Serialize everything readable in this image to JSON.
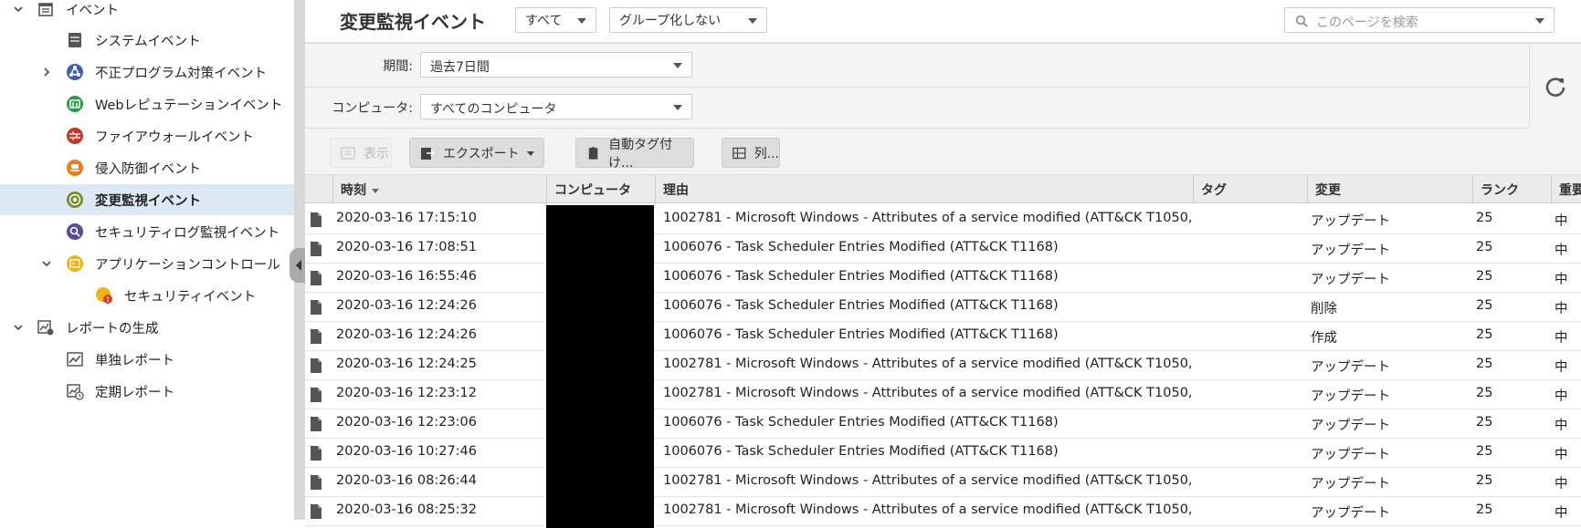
{
  "sidebar": {
    "items": [
      {
        "label": "イベント",
        "icon": "calendar-icon"
      },
      {
        "label": "システムイベント",
        "icon": "server-icon"
      },
      {
        "label": "不正プログラム対策イベント",
        "icon": "biohazard-icon"
      },
      {
        "label": "Webレピュテーションイベント",
        "icon": "web-reputation-icon"
      },
      {
        "label": "ファイアウォールイベント",
        "icon": "firewall-icon"
      },
      {
        "label": "侵入防御イベント",
        "icon": "intrusion-prevention-icon"
      },
      {
        "label": "変更監視イベント",
        "icon": "integrity-monitoring-icon"
      },
      {
        "label": "セキュリティログ監視イベント",
        "icon": "log-inspection-icon"
      },
      {
        "label": "アプリケーションコントロール",
        "icon": "application-control-icon"
      },
      {
        "label": "セキュリティイベント",
        "icon": "security-event-icon"
      },
      {
        "label": "レポートの生成",
        "icon": "report-generate-icon"
      },
      {
        "label": "単独レポート",
        "icon": "single-report-icon"
      },
      {
        "label": "定期レポート",
        "icon": "scheduled-report-icon"
      }
    ]
  },
  "header": {
    "title": "変更監視イベント",
    "filter_all": "すべて",
    "group_by": "グループ化しない",
    "search_placeholder": "このページを検索"
  },
  "filters": {
    "period_label": "期間:",
    "period_value": "過去7日間",
    "computer_label": "コンピュータ:",
    "computer_value": "すべてのコンピュータ"
  },
  "toolbar": {
    "view": "表示",
    "export": "エクスポート",
    "auto_tag": "自動タグ付け...",
    "columns": "列..."
  },
  "table": {
    "headers": [
      "時刻",
      "コンピュータ",
      "理由",
      "タグ",
      "変更",
      "ランク",
      "重要"
    ],
    "rows": [
      {
        "time": "2020-03-16 17:15:10",
        "reason": "1002781 - Microsoft Windows - Attributes of a service modified (ATT&CK T1050, ...",
        "change": "アップデート",
        "rank": "25",
        "severity": "中"
      },
      {
        "time": "2020-03-16 17:08:51",
        "reason": "1006076 - Task Scheduler Entries Modified (ATT&CK T1168)",
        "change": "アップデート",
        "rank": "25",
        "severity": "中"
      },
      {
        "time": "2020-03-16 16:55:46",
        "reason": "1006076 - Task Scheduler Entries Modified (ATT&CK T1168)",
        "change": "アップデート",
        "rank": "25",
        "severity": "中"
      },
      {
        "time": "2020-03-16 12:24:26",
        "reason": "1006076 - Task Scheduler Entries Modified (ATT&CK T1168)",
        "change": "削除",
        "rank": "25",
        "severity": "中"
      },
      {
        "time": "2020-03-16 12:24:26",
        "reason": "1006076 - Task Scheduler Entries Modified (ATT&CK T1168)",
        "change": "作成",
        "rank": "25",
        "severity": "中"
      },
      {
        "time": "2020-03-16 12:24:25",
        "reason": "1002781 - Microsoft Windows - Attributes of a service modified (ATT&CK T1050, ...",
        "change": "アップデート",
        "rank": "25",
        "severity": "中"
      },
      {
        "time": "2020-03-16 12:23:12",
        "reason": "1002781 - Microsoft Windows - Attributes of a service modified (ATT&CK T1050, ...",
        "change": "アップデート",
        "rank": "25",
        "severity": "中"
      },
      {
        "time": "2020-03-16 12:23:06",
        "reason": "1006076 - Task Scheduler Entries Modified (ATT&CK T1168)",
        "change": "アップデート",
        "rank": "25",
        "severity": "中"
      },
      {
        "time": "2020-03-16 10:27:46",
        "reason": "1006076 - Task Scheduler Entries Modified (ATT&CK T1168)",
        "change": "アップデート",
        "rank": "25",
        "severity": "中"
      },
      {
        "time": "2020-03-16 08:26:44",
        "reason": "1002781 - Microsoft Windows - Attributes of a service modified (ATT&CK T1050, ...",
        "change": "アップデート",
        "rank": "25",
        "severity": "中"
      },
      {
        "time": "2020-03-16 08:25:32",
        "reason": "1002781 - Microsoft Windows - Attributes of a service modified (ATT&CK T1050, ...",
        "change": "アップデート",
        "rank": "25",
        "severity": "中"
      }
    ]
  },
  "colors": {
    "selected_row": "#dde8f5",
    "toolbar_bg": "#f4f4f4",
    "header_bg": "#ebebeb"
  }
}
